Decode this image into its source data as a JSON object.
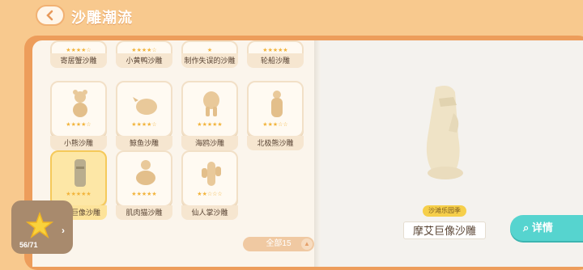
{
  "header": {
    "title": "沙雕潮流"
  },
  "top_row": [
    {
      "label": "寄居蟹沙雕",
      "stars": "★★★★☆"
    },
    {
      "label": "小黄鸭沙雕",
      "stars": "★★★★☆"
    },
    {
      "label": "制作失误的沙雕",
      "stars": "★"
    },
    {
      "label": "轮船沙雕",
      "stars": "★★★★★"
    }
  ],
  "row2": [
    {
      "label": "小熊沙雕",
      "stars": "★★★★☆"
    },
    {
      "label": "鲸鱼沙雕",
      "stars": "★★★★☆"
    },
    {
      "label": "海鸥沙雕",
      "stars": "★★★★★"
    },
    {
      "label": "北极熊沙雕",
      "stars": "★★★☆☆"
    }
  ],
  "row3": [
    {
      "label": "摩艾巨像沙雕",
      "stars": "★★★★★"
    },
    {
      "label": "肌肉猫沙雕",
      "stars": "★★★★★"
    },
    {
      "label": "仙人掌沙雕",
      "stars": "★★☆☆☆"
    }
  ],
  "filter": {
    "label": "全部15"
  },
  "collection": {
    "count": "56/71"
  },
  "detail_panel": {
    "badge": "沙滩乐园季",
    "name": "摩艾巨像沙雕",
    "detail_button": "详情"
  },
  "colors": {
    "accent": "#56d4cf",
    "background": "#f8c98e",
    "book": "#ed9d5b"
  }
}
